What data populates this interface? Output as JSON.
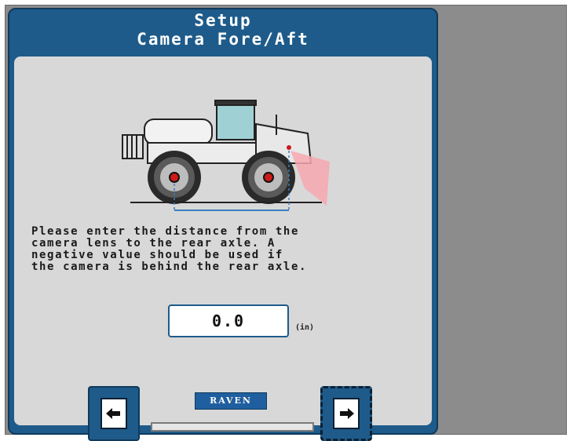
{
  "header": {
    "title": "Setup",
    "subtitle": "Camera Fore/Aft"
  },
  "instruction": "Please enter the distance from the\ncamera lens to the rear axle. A\nnegative value should be used if\nthe camera is behind the rear axle.",
  "distance_input": {
    "value": "0.0",
    "unit": "(in)"
  },
  "logo_text": "RAVEN",
  "progress": 0,
  "icons": {
    "back": "back-arrow-icon",
    "next": "next-arrow-icon"
  },
  "colors": {
    "panel_blue": "#1e5b8a",
    "content_gray": "#d8d8d8",
    "camera_marker": "#cc1a1a",
    "camera_view": "#f7a8b0",
    "measure_line": "#3a7fbf"
  }
}
